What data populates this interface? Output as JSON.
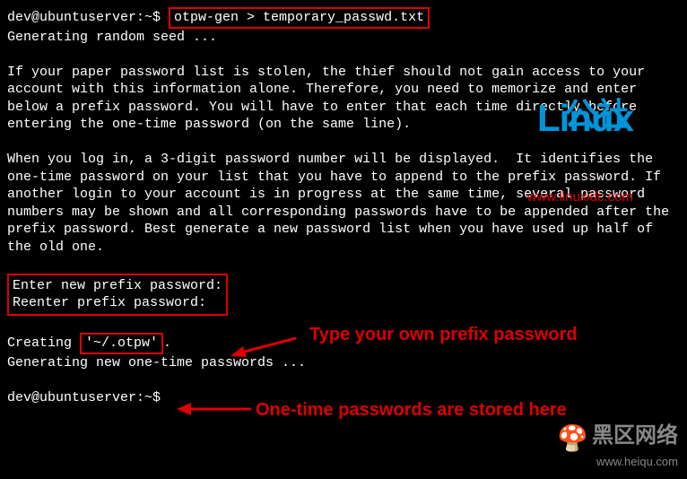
{
  "terminal": {
    "prompt1": "dev@ubuntuserver:~$ ",
    "command": "otpw-gen > temporary_passwd.txt",
    "line_seed": "Generating random seed ...",
    "para1": "If your paper password list is stolen, the thief should not gain access to your account with this information alone. Therefore, you need to memorize and enter below a prefix password. You will have to enter that each time directly before entering the one-time password (on the same line).",
    "para2": "When you log in, a 3-digit password number will be displayed.  It identifies the one-time password on your list that you have to append to the prefix password. If another login to your account is in progress at the same time, several password numbers may be shown and all corresponding passwords have to be appended after the prefix password. Best generate a new password list when you have used up half of the old one.",
    "enter_new": "Enter new prefix password:",
    "reenter": "Reenter prefix password:",
    "creating_pre": "Creating ",
    "creating_path": "'~/.otpw'",
    "creating_post": ".",
    "generating": "Generating new one-time passwords ...",
    "prompt2": "dev@ubuntuserver:~$"
  },
  "annotations": {
    "anno1": "Type your own prefix password",
    "anno2": "One-time passwords are stored here"
  },
  "watermark_linux": {
    "logo": "Linux",
    "chinese": "公社",
    "url": "www.linuxidc.com"
  },
  "watermark_heiqu": {
    "chinese": "黑区网络",
    "url": "www.heiqu.com"
  }
}
